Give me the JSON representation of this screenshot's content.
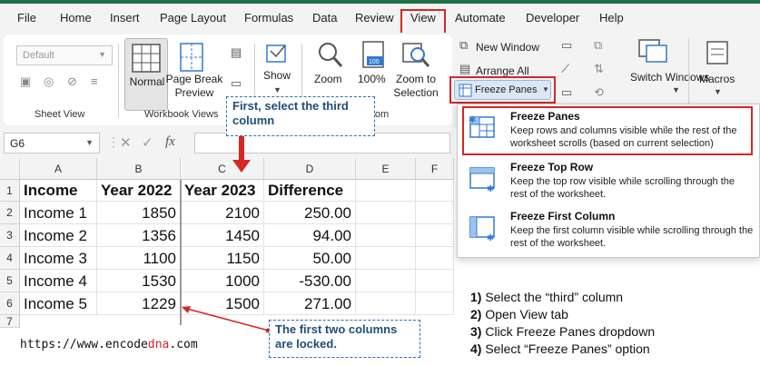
{
  "menubar": {
    "tabs": [
      "File",
      "Home",
      "Insert",
      "Page Layout",
      "Formulas",
      "Data",
      "Review",
      "View",
      "Automate",
      "Developer",
      "Help"
    ],
    "active_tab": "View"
  },
  "ribbon": {
    "sheet_view": {
      "dropdown_value": "Default",
      "group_label": "Sheet View"
    },
    "workbook_views": {
      "normal_label": "Normal",
      "page_break_label": "Page Break Preview",
      "group_label": "Workbook Views"
    },
    "show": {
      "label": "Show"
    },
    "zoom": {
      "zoom_label": "Zoom",
      "hundred_label": "100%",
      "selection_label": "Zoom to Selection",
      "group_label": "Zoom"
    },
    "window": {
      "new_window_label": "New Window",
      "arrange_all_label": "Arrange All",
      "freeze_panes_label": "Freeze Panes",
      "switch_windows_label": "Switch Windows",
      "macros_label": "Macros"
    }
  },
  "formula_bar": {
    "name_box": "G6",
    "fx_label": "fx"
  },
  "sheet": {
    "columns": [
      "A",
      "B",
      "C",
      "D",
      "E",
      "F"
    ],
    "rows": [
      "1",
      "2",
      "3",
      "4",
      "5",
      "6",
      "7"
    ],
    "header": [
      "Income",
      "Year 2022",
      "Year 2023",
      "Difference"
    ],
    "data": [
      [
        "Income 1",
        "1850",
        "2100",
        "250.00"
      ],
      [
        "Income 2",
        "1356",
        "1450",
        "94.00"
      ],
      [
        "Income 3",
        "1100",
        "1150",
        "50.00"
      ],
      [
        "Income 4",
        "1530",
        "1000",
        "-530.00"
      ],
      [
        "Income 5",
        "1229",
        "1500",
        "271.00"
      ]
    ]
  },
  "dropdown": {
    "items": [
      {
        "title": "Freeze Panes",
        "desc": "Keep rows and columns visible while the rest of the worksheet scrolls (based on current selection)"
      },
      {
        "title": "Freeze Top Row",
        "desc": "Keep the top row visible while scrolling through the rest of the worksheet."
      },
      {
        "title": "Freeze First Column",
        "desc": "Keep the first column visible while scrolling through the rest of the worksheet."
      }
    ]
  },
  "annotations": {
    "select_note": "First, select the third column",
    "locked_note": "The first two columns are locked.",
    "steps": [
      {
        "num": "1)",
        "text": "Select the “third” column"
      },
      {
        "num": "2)",
        "text": "Open View tab"
      },
      {
        "num": "3)",
        "text": "Click Freeze Panes dropdown"
      },
      {
        "num": "4)",
        "text": "Select “Freeze Panes” option"
      }
    ],
    "url_prefix": "https://www.encode",
    "url_accent": "dna",
    "url_suffix": ".com"
  },
  "colors": {
    "accent_green": "#1e7145",
    "highlight_red": "#d42727",
    "note_blue": "#1f4e79",
    "icon_blue": "#2f7ad1"
  },
  "icons": [
    "chevron-down-icon",
    "eye-icon",
    "list-icon",
    "grid-icon",
    "page-break-icon",
    "zoom-icon",
    "zoom-100-icon",
    "zoom-selection-icon",
    "new-window-icon",
    "freeze-icon",
    "switch-windows-icon",
    "macros-icon",
    "close-icon",
    "check-icon"
  ]
}
